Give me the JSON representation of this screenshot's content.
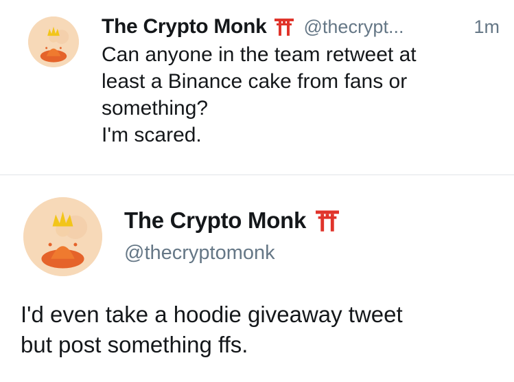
{
  "tweet_compact": {
    "display_name": "The Crypto Monk",
    "name_emoji": "torii-gate-icon",
    "handle": "@thecrypt...",
    "timestamp": "1m",
    "text": "Can anyone in the team retweet at\nleast a Binance cake from fans or\nsomething?\nI'm scared."
  },
  "tweet_expanded": {
    "display_name": "The Crypto Monk",
    "name_emoji": "torii-gate-icon",
    "handle": "@thecryptomonk",
    "text": "I'd even take a hoodie giveaway tweet\nbut post something ffs."
  },
  "colors": {
    "text": "#14171a",
    "secondary": "#657786",
    "divider": "#e1e4e8",
    "torii": "#e0342b",
    "avatar_bg": "#f7d9b8"
  }
}
